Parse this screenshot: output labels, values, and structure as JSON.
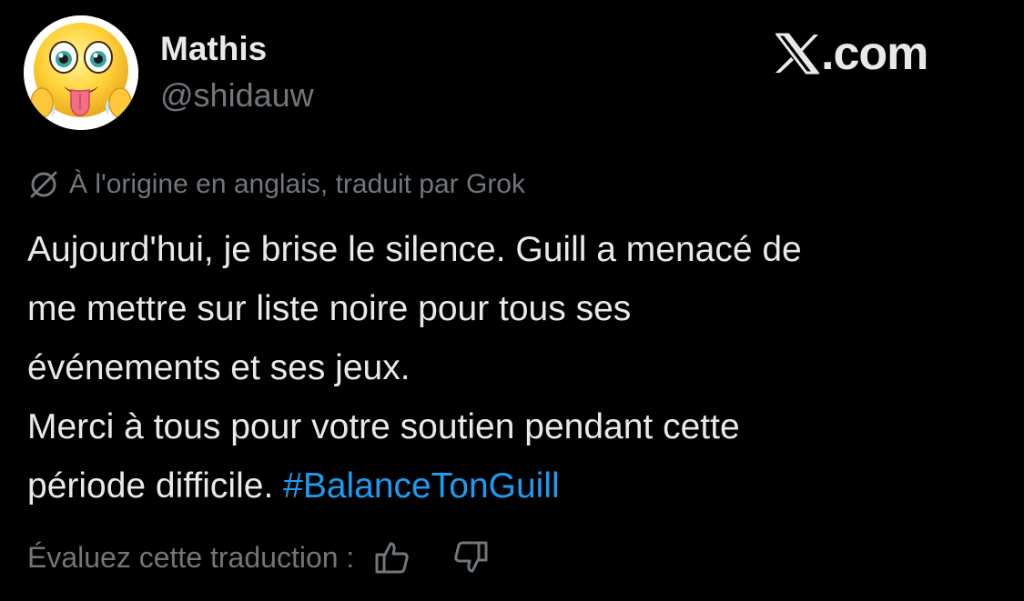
{
  "author": {
    "name": "Mathis",
    "handle": "@shidauw"
  },
  "brand": {
    "text": ".com",
    "logo_icon": "x-logo-icon"
  },
  "translation_note": {
    "icon": "translate-icon",
    "text": "À l'origine en anglais, traduit par Grok"
  },
  "tweet": {
    "lines": [
      "Aujourd'hui, je brise le silence. Guill a menacé de",
      "me mettre sur liste noire pour tous ses",
      "événements et ses jeux.",
      "Merci à tous pour votre soutien pendant cette"
    ],
    "last_line_text": "période difficile. ",
    "hashtag": "#BalanceTonGuill"
  },
  "rating": {
    "label": "Évaluez cette traduction :",
    "thumbs_up_icon": "thumbs-up-icon",
    "thumbs_down_icon": "thumbs-down-icon"
  },
  "colors": {
    "background": "#000000",
    "primary_text": "#e7e9ea",
    "secondary_text": "#71767b",
    "hashtag": "#1d9bf0"
  }
}
